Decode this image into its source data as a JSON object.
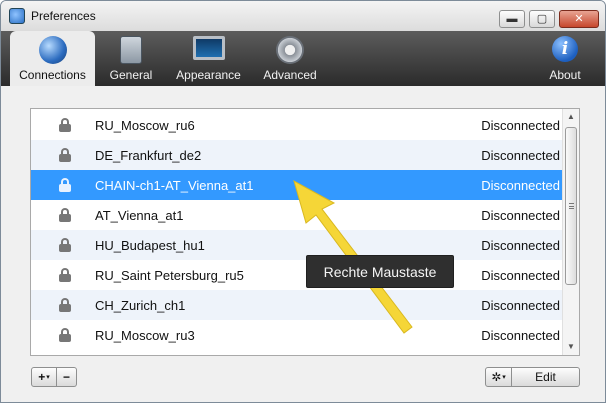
{
  "window": {
    "title": "Preferences",
    "icon": "app-icon",
    "controls": {
      "minimize": "▬",
      "maximize": "▢",
      "close": "✕"
    }
  },
  "toolbar": {
    "tabs": [
      {
        "label": "Connections",
        "icon": "globe-network-icon",
        "active": true
      },
      {
        "label": "General",
        "icon": "switch-panel-icon",
        "active": false
      },
      {
        "label": "Appearance",
        "icon": "monitor-icon",
        "active": false
      },
      {
        "label": "Advanced",
        "icon": "gear-icon",
        "active": false
      }
    ],
    "about": {
      "label": "About",
      "icon": "info-icon",
      "glyph": "i"
    }
  },
  "connections": {
    "rows": [
      {
        "name": "RU_Moscow_ru6",
        "status": "Disconnected"
      },
      {
        "name": "DE_Frankfurt_de2",
        "status": "Disconnected"
      },
      {
        "name": "CHAIN-ch1-AT_Vienna_at1",
        "status": "Disconnected",
        "selected": true
      },
      {
        "name": "AT_Vienna_at1",
        "status": "Disconnected"
      },
      {
        "name": "HU_Budapest_hu1",
        "status": "Disconnected"
      },
      {
        "name": "RU_Saint Petersburg_ru5",
        "status": "Disconnected"
      },
      {
        "name": "CH_Zurich_ch1",
        "status": "Disconnected"
      },
      {
        "name": "RU_Moscow_ru3",
        "status": "Disconnected"
      }
    ]
  },
  "annotation": {
    "tooltip": "Rechte Maustaste",
    "arrow_color": "#f5d637"
  },
  "bottom_bar": {
    "add_label": "+",
    "add_caret": "▾",
    "remove_label": "−",
    "gear_glyph": "✲",
    "gear_caret": "▾",
    "edit_label": "Edit"
  },
  "scrollbar": {
    "up_arrow": "▲",
    "down_arrow": "▼"
  },
  "colors": {
    "selection": "#3399ff",
    "alt_row": "#eef3fa",
    "toolbar_dark": "#2b2b2b"
  }
}
